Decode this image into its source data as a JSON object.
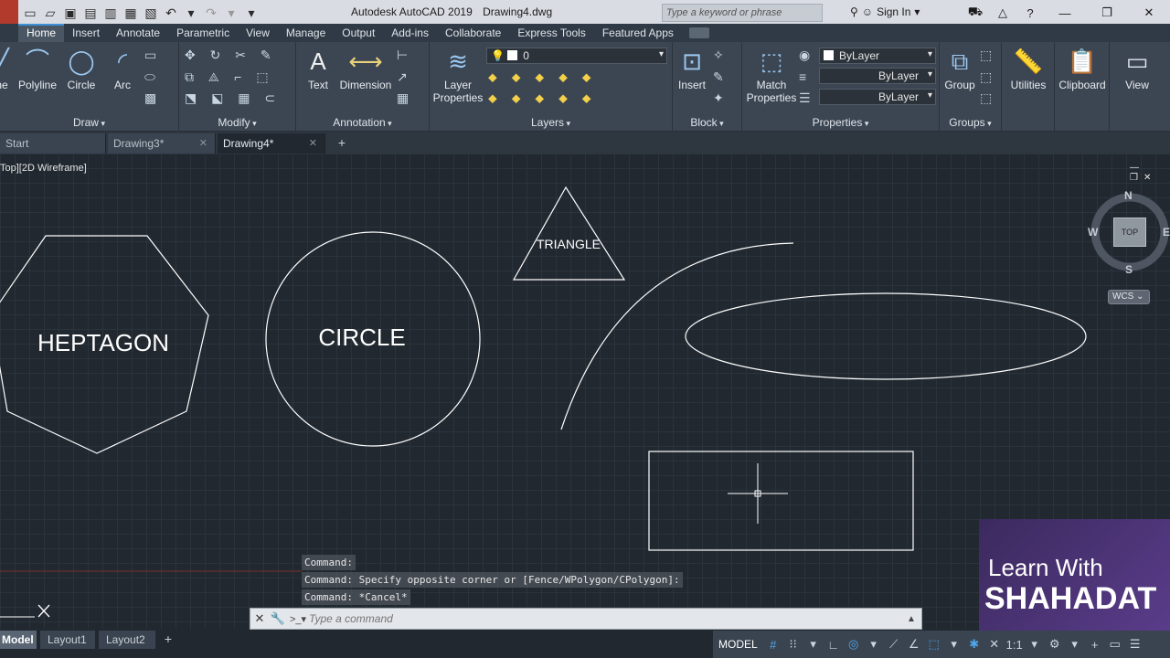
{
  "titlebar": {
    "app_name": "Autodesk AutoCAD 2019",
    "file_name": "Drawing4.dwg",
    "search_placeholder": "Type a keyword or phrase",
    "sign_in": "Sign In"
  },
  "ribbon_tabs": [
    "Home",
    "Insert",
    "Annotate",
    "Parametric",
    "View",
    "Manage",
    "Output",
    "Add-ins",
    "Collaborate",
    "Express Tools",
    "Featured Apps"
  ],
  "ribbon": {
    "draw": {
      "title": "Draw",
      "tools": [
        "ne",
        "Polyline",
        "Circle",
        "Arc"
      ]
    },
    "modify": {
      "title": "Modify"
    },
    "annotation": {
      "title": "Annotation",
      "tools": [
        "Text",
        "Dimension"
      ]
    },
    "layers": {
      "title": "Layers",
      "tool": "Layer Properties",
      "current_layer": "0"
    },
    "block": {
      "title": "Block",
      "tool": "Insert"
    },
    "properties": {
      "title": "Properties",
      "tool": "Match Properties",
      "color": "ByLayer",
      "linetype": "ByLayer",
      "lineweight": "ByLayer"
    },
    "groups": {
      "title": "Groups",
      "tool": "Group"
    },
    "utilities": "Utilities",
    "clipboard": "Clipboard",
    "view": "View"
  },
  "doc_tabs": [
    "Start",
    "Drawing3*",
    "Drawing4*"
  ],
  "viewport_label": "Top][2D Wireframe]",
  "shapes": {
    "heptagon": "HEPTAGON",
    "circle": "CIRCLE",
    "triangle": "TRIANGLE"
  },
  "viewcube": {
    "top": "TOP",
    "north": "N",
    "south": "S",
    "west": "W",
    "east": "E",
    "wcs": "WCS"
  },
  "command_history": [
    "Command:",
    "Command: Specify opposite corner or [Fence/WPolygon/CPolygon]:",
    "Command: *Cancel*"
  ],
  "command_line": {
    "placeholder": "Type a command"
  },
  "layout_tabs": [
    "Model",
    "Layout1",
    "Layout2"
  ],
  "status": {
    "model": "MODEL",
    "scale": "1:1"
  },
  "watermark": {
    "line1": "Learn With",
    "line2": "SHAHADAT"
  },
  "colors": {
    "accent": "#3f8fd6",
    "canvas": "#212830",
    "ribbon": "#3c4653"
  }
}
